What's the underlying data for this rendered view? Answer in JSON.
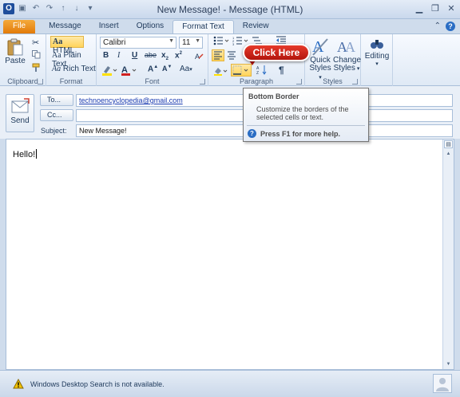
{
  "window": {
    "title": "New Message!  -  Message (HTML)"
  },
  "tabs": [
    {
      "label": "File"
    },
    {
      "label": "Message"
    },
    {
      "label": "Insert"
    },
    {
      "label": "Options"
    },
    {
      "label": "Format Text"
    },
    {
      "label": "Review"
    }
  ],
  "ribbon": {
    "clipboard": {
      "paste_label": "Paste",
      "group_label": "Clipboard"
    },
    "format": {
      "html_label": "HTML",
      "plain_label": "Plain Text",
      "rich_label": "Rich Text",
      "group_label": "Format",
      "selected": "HTML"
    },
    "font": {
      "font_name": "Calibri",
      "font_size": "11",
      "group_label": "Font"
    },
    "paragraph": {
      "group_label": "Paragraph"
    },
    "styles": {
      "quick_label_1": "Quick",
      "quick_label_2": "Styles",
      "change_label_1": "Change",
      "change_label_2": "Styles",
      "group_label": "Styles"
    },
    "editing": {
      "label": "Editing"
    }
  },
  "callout": {
    "text": "Click Here"
  },
  "tooltip": {
    "title": "Bottom Border",
    "body": "Customize the borders of the selected cells or text.",
    "help": "Press F1 for more help."
  },
  "header": {
    "send_label": "Send",
    "to_label": "To...",
    "cc_label": "Cc...",
    "subject_label": "Subject:",
    "to_value": "technoencyclopedia@gmail.com",
    "cc_value": "",
    "subject_value": "New Message!"
  },
  "body": {
    "text": "Hello!"
  },
  "status": {
    "text": "Windows Desktop Search is not available."
  },
  "colors": {
    "accent": "#e27b0a",
    "ribbon": "#dfe9f5",
    "callout": "#c41e12"
  }
}
